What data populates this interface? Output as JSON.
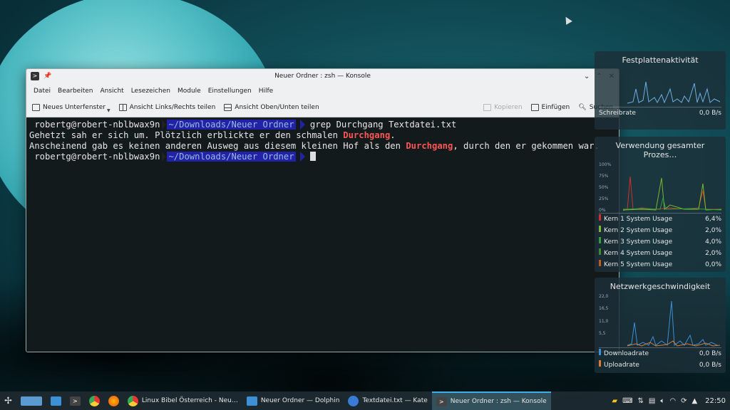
{
  "window": {
    "title": "Neuer Ordner : zsh — Konsole",
    "menu": [
      "Datei",
      "Bearbeiten",
      "Ansicht",
      "Lesezeichen",
      "Module",
      "Einstellungen",
      "Hilfe"
    ],
    "toolbar": {
      "new_tab": "Neues Unterfenster",
      "split_lr": "Ansicht Links/Rechts teilen",
      "split_tb": "Ansicht Oben/Unten teilen",
      "copy": "Kopieren",
      "paste": "Einfügen",
      "search": "Suchen"
    }
  },
  "terminal": {
    "user": "robertg@robert-nblbwax9n",
    "path": "~/Downloads/Neuer Ordner",
    "command": "grep Durchgang Textdatei.txt",
    "line1_before": "Gehetzt sah er sich um. Plötzlich erblickte er den schmalen ",
    "line1_match": "Durchgang",
    "line1_after": ".",
    "line2_before": "Anscheinend gab es keinen anderen Ausweg aus diesem kleinen Hof als den ",
    "line2_match": "Durchgang",
    "line2_after": ", durch den er gekommen war."
  },
  "widgets": {
    "disk": {
      "title": "Festplattenaktivität",
      "rows": [
        {
          "label": "Schreibrate",
          "value": "0,0 B/s"
        }
      ]
    },
    "cpu": {
      "title": "Verwendung gesamter Prozes…",
      "ticks": [
        "100%",
        "75%",
        "50%",
        "25%",
        "0%"
      ],
      "rows": [
        {
          "label": "Kern 1 System Usage",
          "value": "6,4%",
          "color": "#d0302a"
        },
        {
          "label": "Kern 2 System Usage",
          "value": "2,0%",
          "color": "#7bb72e"
        },
        {
          "label": "Kern 3 System Usage",
          "value": "4,0%",
          "color": "#2e9f3a"
        },
        {
          "label": "Kern 4 System Usage",
          "value": "2,0%",
          "color": "#3a8c2e"
        },
        {
          "label": "Kern 5 System Usage",
          "value": "0,0%",
          "color": "#c05a20"
        }
      ]
    },
    "net": {
      "title": "Netzwerkgeschwindigkeit",
      "ticks": [
        "22,0",
        "16,5",
        "11,0",
        "5,5"
      ],
      "rows": [
        {
          "label": "Downloadrate",
          "value": "0,0 B/s",
          "color": "#3d8fd6"
        },
        {
          "label": "Uploadrate",
          "value": "0,0 B/s",
          "color": "#e07a2e"
        }
      ]
    }
  },
  "taskbar": {
    "tasks": [
      {
        "label": "Linux Bibel Österreich - Neu…",
        "icon": "chrome-icon"
      },
      {
        "label": "Neuer Ordner — Dolphin",
        "icon": "folder-icon"
      },
      {
        "label": "Textdatei.txt — Kate",
        "icon": "kate-icon"
      },
      {
        "label": "Neuer Ordner : zsh — Konsole",
        "icon": "terminal-icon"
      }
    ],
    "clock": "22:50"
  }
}
